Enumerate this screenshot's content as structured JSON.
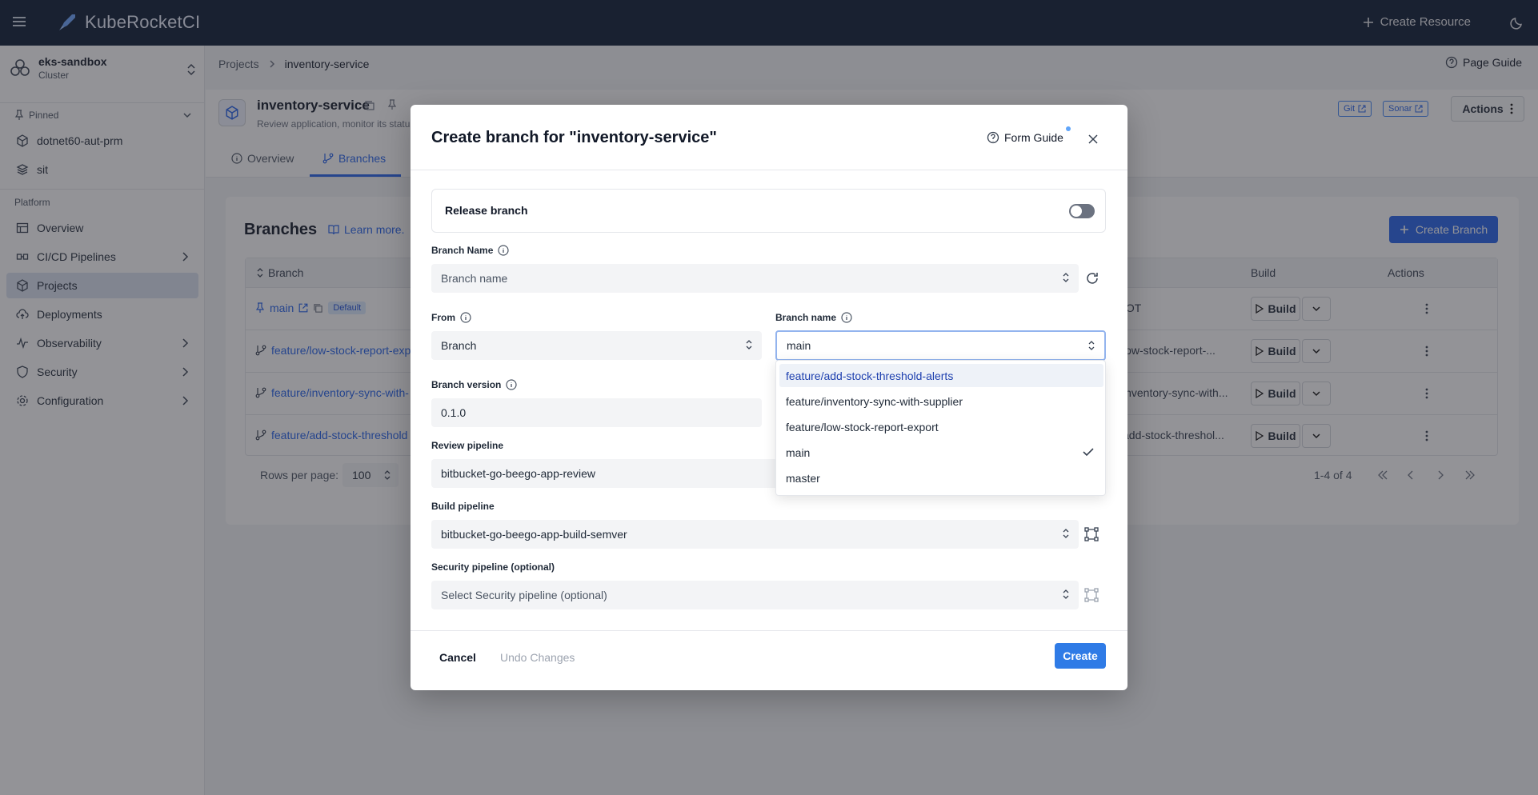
{
  "topbar": {
    "brand": "KubeRocketCI",
    "create_resource": "Create Resource"
  },
  "sidebar": {
    "cluster": {
      "name": "eks-sandbox",
      "type": "Cluster"
    },
    "pinned_label": "Pinned",
    "pinned": [
      {
        "label": "dotnet60-aut-prm"
      },
      {
        "label": "sit"
      }
    ],
    "platform_label": "Platform",
    "items": [
      {
        "label": "Overview"
      },
      {
        "label": "CI/CD Pipelines"
      },
      {
        "label": "Projects"
      },
      {
        "label": "Deployments"
      },
      {
        "label": "Observability"
      },
      {
        "label": "Security"
      },
      {
        "label": "Configuration"
      }
    ]
  },
  "breadcrumb": {
    "root": "Projects",
    "current": "inventory-service"
  },
  "page_guide": "Page Guide",
  "project": {
    "title": "inventory-service",
    "subtitle": "Review application, monitor its statu",
    "tags": [
      "Git",
      "Sonar"
    ],
    "actions": "Actions"
  },
  "tabs": [
    {
      "label": "Overview"
    },
    {
      "label": "Branches"
    }
  ],
  "branches": {
    "title": "Branches",
    "learn_more": "Learn more.",
    "create_branch": "Create Branch",
    "columns": {
      "branch": "Branch",
      "build": "Build",
      "actions": "Actions"
    },
    "default_badge": "Default",
    "build_label": "Build",
    "rows": [
      {
        "name": "main",
        "version": "IOT"
      },
      {
        "name": "feature/low-stock-report-exp",
        "version": "low-stock-report-..."
      },
      {
        "name": "feature/inventory-sync-with-",
        "version": "inventory-sync-with..."
      },
      {
        "name": "feature/add-stock-threshold",
        "version": "add-stock-threshol..."
      }
    ],
    "rows_per_page_label": "Rows per page:",
    "rows_per_page": "100",
    "range": "1-4 of 4"
  },
  "modal": {
    "title": "Create branch for \"inventory-service\"",
    "form_guide": "Form Guide",
    "release_branch": "Release branch",
    "branch_name_label": "Branch Name",
    "branch_name_placeholder": "Branch name",
    "from_label": "From",
    "from_value": "Branch",
    "source_branch_label": "Branch name",
    "source_branch_value": "main",
    "branch_version_label": "Branch version",
    "branch_version_value": "0.1.0",
    "review_pipeline_label": "Review pipeline",
    "review_pipeline_value": "bitbucket-go-beego-app-review",
    "build_pipeline_label": "Build pipeline",
    "build_pipeline_value": "bitbucket-go-beego-app-build-semver",
    "security_pipeline_label": "Security pipeline (optional)",
    "security_pipeline_placeholder": "Select Security pipeline (optional)",
    "cancel": "Cancel",
    "undo": "Undo Changes",
    "create": "Create",
    "dropdown_options": [
      {
        "label": "feature/add-stock-threshold-alerts"
      },
      {
        "label": "feature/inventory-sync-with-supplier"
      },
      {
        "label": "feature/low-stock-report-export"
      },
      {
        "label": "main"
      },
      {
        "label": "master"
      }
    ]
  },
  "colors": {
    "topbar": "#0b1a33",
    "accent": "#2563eb",
    "create_button": "#2f7be6"
  }
}
